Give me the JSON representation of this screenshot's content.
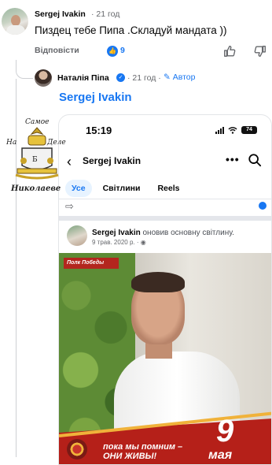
{
  "comment": {
    "author": "Sergej Ivakin",
    "time": "· 21 год",
    "text": "Пиздец тебе Пипа .Складуй мандата ))",
    "reply_label": "Відповісти",
    "like_count": "9"
  },
  "reply": {
    "author": "Наталія Піпа",
    "time": "· 21 год ·",
    "author_tag": "✎ Автор",
    "mention": "Sergej Ivakin"
  },
  "screenshot": {
    "status_time": "15:19",
    "battery": "74",
    "profile_name": "Sergej Ivakin",
    "more_label": "•••",
    "tabs": [
      "Усе",
      "Світлини",
      "Reels"
    ],
    "post": {
      "author": "Sergej Ivakin",
      "action": " оновив основну світлину.",
      "date": "9 трав. 2020 р. · ◉"
    },
    "photo": {
      "corner_label": "Полк Победы",
      "slogan_line1": "пока мы помним –",
      "slogan_line2": "ОНИ ЖИВЫ!",
      "day": "9",
      "month": "мая"
    }
  },
  "watermark": {
    "top": "Самое",
    "left": "На",
    "right": "Деле",
    "bottom": "Николаеве",
    "center": "Б"
  },
  "colors": {
    "accent": "#1877f2",
    "muted": "#65676b",
    "banner_red": "#b52019"
  }
}
